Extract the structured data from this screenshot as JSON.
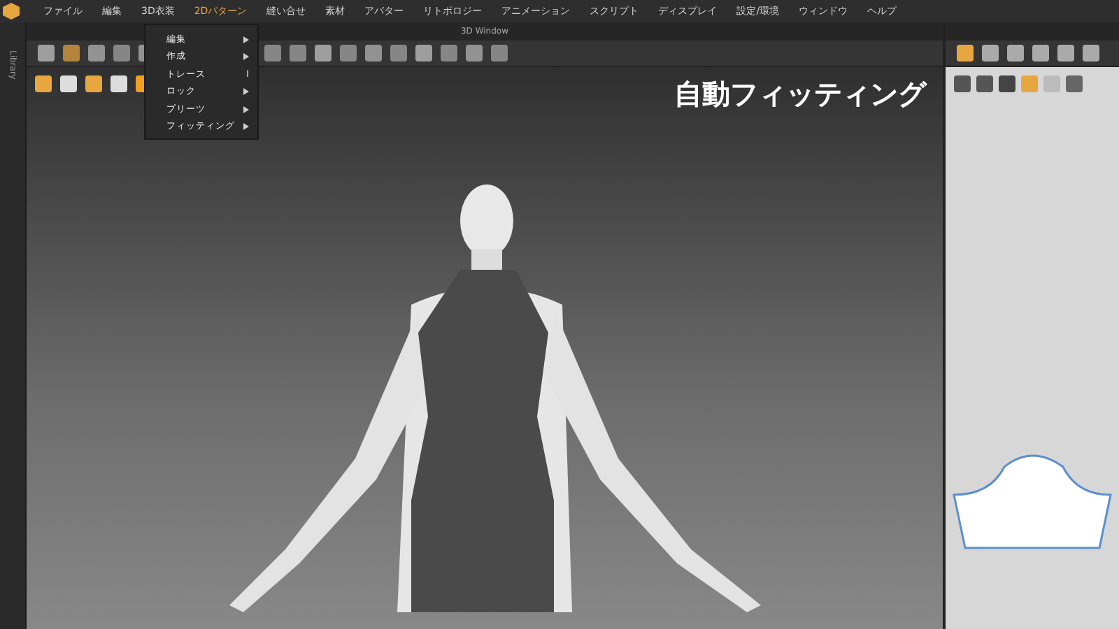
{
  "menubar": [
    {
      "label": "ファイル",
      "selected": false
    },
    {
      "label": "編集",
      "selected": false
    },
    {
      "label": "3D衣装",
      "selected": false
    },
    {
      "label": "2Dパターン",
      "selected": true
    },
    {
      "label": "縫い合せ",
      "selected": false
    },
    {
      "label": "素材",
      "selected": false
    },
    {
      "label": "アバター",
      "selected": false
    },
    {
      "label": "リトポロジー",
      "selected": false
    },
    {
      "label": "アニメーション",
      "selected": false
    },
    {
      "label": "スクリプト",
      "selected": false
    },
    {
      "label": "ディスプレイ",
      "selected": false
    },
    {
      "label": "設定/環境",
      "selected": false
    },
    {
      "label": "ウィンドウ",
      "selected": false
    },
    {
      "label": "ヘルプ",
      "selected": false
    }
  ],
  "dropdown": [
    {
      "label": "編集",
      "kind": "submenu"
    },
    {
      "label": "作成",
      "kind": "submenu"
    },
    {
      "label": "トレース",
      "kind": "command",
      "shortcut": "I"
    },
    {
      "label": "ロック",
      "kind": "submenu"
    },
    {
      "label": "プリーツ",
      "kind": "submenu"
    },
    {
      "label": "フィッティング",
      "kind": "submenu"
    }
  ],
  "sidebar": {
    "label": "Library"
  },
  "viewport": {
    "title": "3D Window",
    "caption": "自動フィッティング"
  }
}
